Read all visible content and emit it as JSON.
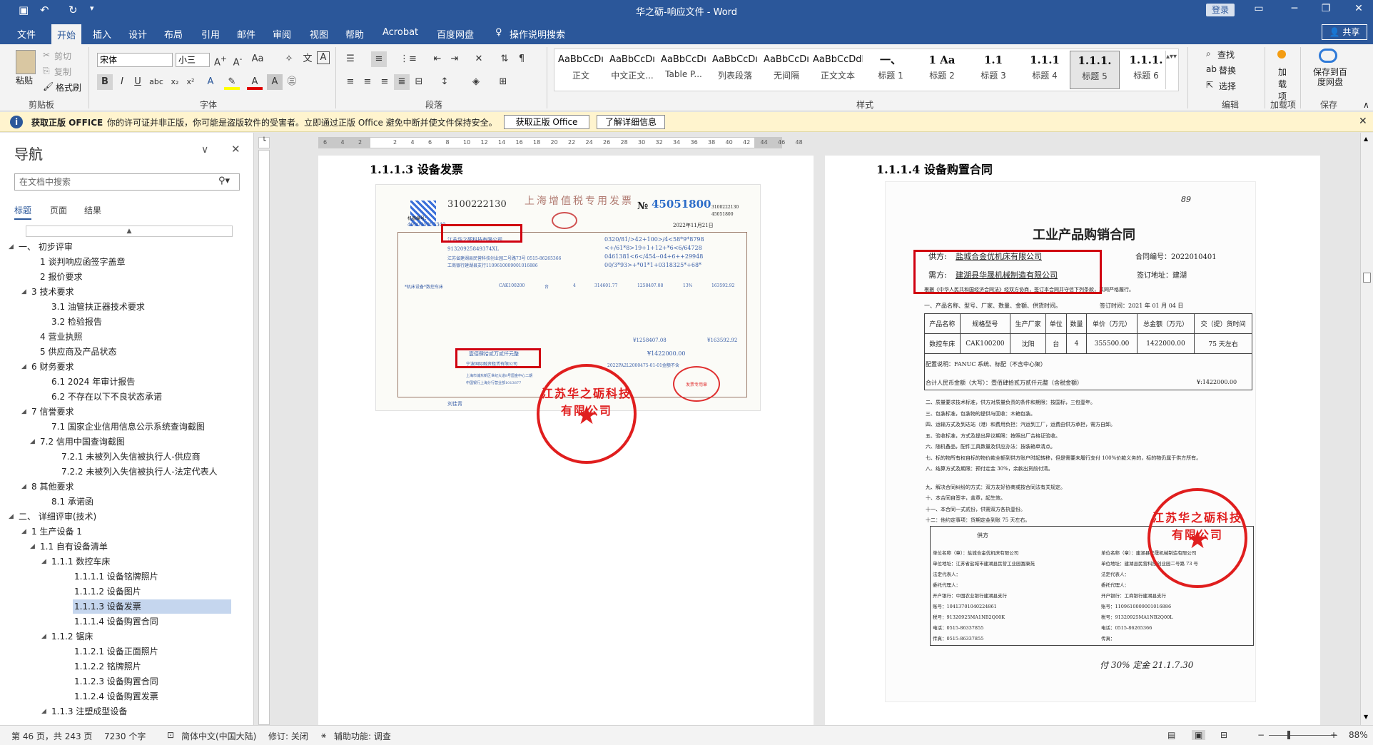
{
  "window": {
    "title": "华之砺-响应文件 - Word",
    "login_label": "登录",
    "share_label": "共享"
  },
  "tabs": [
    "文件",
    "开始",
    "插入",
    "设计",
    "布局",
    "引用",
    "邮件",
    "审阅",
    "视图",
    "帮助",
    "Acrobat",
    "百度网盘",
    "操作说明搜索"
  ],
  "ribbon": {
    "clipboard": {
      "paste": "粘贴",
      "cut": "剪切",
      "copy": "复制",
      "format_painter": "格式刷",
      "group": "剪贴板"
    },
    "font": {
      "name": "宋体",
      "size": "小三",
      "group": "字体"
    },
    "paragraph": {
      "group": "段落"
    },
    "styles": {
      "group": "样式",
      "items": [
        {
          "preview": "AaBbCcDı",
          "name": "正文"
        },
        {
          "preview": "AaBbCcDı",
          "name": "中文正文..."
        },
        {
          "preview": "AaBbCcDı",
          "name": "Table P..."
        },
        {
          "preview": "AaBbCcDı",
          "name": "列表段落"
        },
        {
          "preview": "AaBbCcDı",
          "name": "无间隔"
        },
        {
          "preview": "AaBbCcDdI",
          "name": "正文文本"
        },
        {
          "preview": "一、",
          "name": "标题 1"
        },
        {
          "preview": "1 Aa",
          "name": "标题 2"
        },
        {
          "preview": "1.1",
          "name": "标题 3"
        },
        {
          "preview": "1.1.1",
          "name": "标题 4"
        },
        {
          "preview": "1.1.1.",
          "name": "标题 5"
        },
        {
          "preview": "1.1.1.",
          "name": "标题 6"
        }
      ]
    },
    "editing": {
      "find": "查找",
      "replace": "替换",
      "select": "选择",
      "group": "编辑"
    },
    "addins": {
      "label": "加载项",
      "group": "加载项"
    },
    "save": {
      "label": "保存到百度网盘",
      "group": "保存"
    }
  },
  "message_bar": {
    "title": "获取正版 OFFICE",
    "text": "你的许可证并非正版，你可能是盗版软件的受害者。立即通过正版 Office 避免中断并使文件保持安全。",
    "button1": "获取正版 Office",
    "button2": "了解详细信息"
  },
  "nav": {
    "title": "导航",
    "search_placeholder": "在文档中搜索",
    "tabs": [
      "标题",
      "页面",
      "结果"
    ],
    "items": [
      {
        "text": "一、 初步评审",
        "level": 0,
        "arrow": "◢"
      },
      {
        "text": "1 谈判响应函签字盖章",
        "level": 2,
        "arrow": ""
      },
      {
        "text": "2 报价要求",
        "level": 2,
        "arrow": ""
      },
      {
        "text": "3 技术要求",
        "level": 1,
        "arrow": "◢"
      },
      {
        "text": "3.1 油管扶正器技术要求",
        "level": 3,
        "arrow": ""
      },
      {
        "text": "3.2 检验报告",
        "level": 3,
        "arrow": ""
      },
      {
        "text": "4 营业执照",
        "level": 2,
        "arrow": ""
      },
      {
        "text": "5 供应商及产品状态",
        "level": 2,
        "arrow": ""
      },
      {
        "text": "6 财务要求",
        "level": 1,
        "arrow": "◢"
      },
      {
        "text": "6.1 2024 年审计报告",
        "level": 3,
        "arrow": ""
      },
      {
        "text": "6.2 不存在以下不良状态承诺",
        "level": 3,
        "arrow": ""
      },
      {
        "text": "7 信誉要求",
        "level": 1,
        "arrow": "◢"
      },
      {
        "text": "7.1 国家企业信用信息公示系统查询截图",
        "level": 3,
        "arrow": ""
      },
      {
        "text": "7.2 信用中国查询截图",
        "level": 2,
        "arrow": "◢"
      },
      {
        "text": "7.2.1 未被列入失信被执行人-供应商",
        "level": 4,
        "arrow": ""
      },
      {
        "text": "7.2.2 未被列入失信被执行人-法定代表人",
        "level": 4,
        "arrow": ""
      },
      {
        "text": "8 其他要求",
        "level": 1,
        "arrow": "◢"
      },
      {
        "text": "8.1 承诺函",
        "level": 3,
        "arrow": ""
      },
      {
        "text": "二、 详细评审(技术)",
        "level": 0,
        "arrow": "◢"
      },
      {
        "text": "1 生产设备 1",
        "level": 1,
        "arrow": "◢"
      },
      {
        "text": "1.1 自有设备清单",
        "level": 2,
        "arrow": "◢"
      },
      {
        "text": "1.1.1 数控车床",
        "level": 3,
        "arrow": "◢"
      },
      {
        "text": "1.1.1.1 设备铭牌照片",
        "level": 5,
        "arrow": ""
      },
      {
        "text": "1.1.1.2 设备图片",
        "level": 5,
        "arrow": ""
      },
      {
        "text": "1.1.1.3 设备发票",
        "level": 5,
        "arrow": "",
        "selected": true
      },
      {
        "text": "1.1.1.4 设备购置合同",
        "level": 5,
        "arrow": ""
      },
      {
        "text": "1.1.2 锯床",
        "level": 3,
        "arrow": "◢"
      },
      {
        "text": "1.1.2.1 设备正面照片",
        "level": 5,
        "arrow": ""
      },
      {
        "text": "1.1.2.2 铭牌照片",
        "level": 5,
        "arrow": ""
      },
      {
        "text": "1.1.2.3 设备购置合同",
        "level": 5,
        "arrow": ""
      },
      {
        "text": "1.1.2.4 设备购置发票",
        "level": 5,
        "arrow": ""
      },
      {
        "text": "1.1.3 注塑成型设备",
        "level": 3,
        "arrow": "◢"
      }
    ]
  },
  "ruler_ticks": [
    "6",
    "4",
    "2",
    "",
    "2",
    "4",
    "6",
    "8",
    "10",
    "12",
    "14",
    "16",
    "18",
    "20",
    "22",
    "24",
    "26",
    "28",
    "30",
    "32",
    "34",
    "36",
    "38",
    "40",
    "42",
    "44",
    "46",
    "48"
  ],
  "pages": {
    "left": {
      "heading": "1.1.1.3  设备发票",
      "invoice": {
        "code": "3100222130",
        "title": "上海增值税专用发票",
        "no_prefix": "№",
        "number": "45051800",
        "code_small": "3100222130",
        "number_small": "45051800",
        "date": "2022年11月21日",
        "buyer_no": "机器编号：",
        "buyer_id": "499090953349",
        "buyer_name": "江苏华之砺科技有限公司",
        "buyer_tax": "91320925849374XL",
        "buyer_addr": "江苏省建湖县民营科技创业园二号路73号 0515-86265366",
        "buyer_bank": "工商银行建湖县支行1109610009001016886",
        "cipher1": "0320/81/>42+100>/4<58*9*8798",
        "cipher2": "<+/61*8>19+1+12+*6<6/64728",
        "cipher3": "0461381<6</454--04+6++29948",
        "cipher4": "00/3*93>+*01*1+0318325*+68*",
        "item": "*机床设备*数控车床",
        "model": "CAK100200",
        "unit": "台",
        "qty": "4",
        "price": "314601.77",
        "amount": "1258407.08",
        "rate": "13%",
        "tax": "163592.92",
        "total_amount": "¥1258407.08",
        "total_tax": "¥163592.92",
        "total_words": "壹佰肆拾贰万贰仟元整",
        "total_small": "¥1422000.00",
        "seller_name": "宁波国际融资租赁有限公司",
        "seller_addr": "上海市浦东新区世纪大道8号国金中心二期",
        "seller_bank": "中国银行上海分行营业部1013877",
        "remark": "2022PA2L2000475-01-01金额不含",
        "payee": "刘佳青",
        "seal_text": "发票专用章",
        "stamp_text": "江苏华之砺科技有限公司"
      }
    },
    "right": {
      "heading": "1.1.1.4  设备购置合同",
      "contract": {
        "page_mark": "89",
        "title": "工业产品购销合同",
        "supplier_label": "供方:",
        "supplier": "盐城合金优机床有限公司",
        "buyer_label": "需方:",
        "buyer": "建湖县华晟机械制造有限公司",
        "contract_no": "合同编号：2022010401",
        "sign_place": "签订地址：建湖",
        "intro": "根据《中华人民共和国经济合同法》经双方协商，签订本合同并守信下列条款，共同严格履行。",
        "clause1": "一、产品名称、型号、厂家、数量、金额、供货时间。",
        "sign_date": "签订时间：2021 年 01 月 04 日",
        "table_headers": [
          "产品名称",
          "规格型号",
          "生产厂家",
          "单位",
          "数量",
          "单价（万元）",
          "总金额（万元）",
          "交（提）货时间"
        ],
        "table_row": [
          "数控车床",
          "CAK100200",
          "沈阳",
          "台",
          "4",
          "355500.00",
          "1422000.00",
          "75 天左右"
        ],
        "config": "配置说明：FANUC 系统、标配（不含中心架）",
        "total": "合计人民币金额（大写）：壹佰肆拾贰万贰仟元整（含税金额）",
        "total_num": "¥:1422000.00",
        "clauses": [
          "二、质量要求技术标准，供方对质量负责的条件和期限：按国标，三包壹年。",
          "三、包装标准，包装物的提供与回收：木箱包装。",
          "四、运输方式及到达站（港）和费用负担：汽运到工厂，运费由供方承担，需方自卸。",
          "五、验收标准，方式及提出异议期限：按照出厂合格证验收。",
          "六、随机备品，配件工具数量及供应办法：按装箱单清点。",
          "七、标的物所有权自标的物价款全额到供方账户时起转移，但是需要未履行支付 100%价款义务的，标的物仍属于供方所有。",
          "八、结算方式及期限：预付定金 30%，余款出货前付清。",
          "九、解决合同纠纷的方式：双方友好协商或按合同法有关规定。",
          "十、本合同自签字，盖章，起生效。",
          "十一、本合同一式贰份，供需双方各执壹份。",
          "十二：他约定事项：货期定金到账 75 天左右。"
        ],
        "supplier_block_title": "供方",
        "s_unit": "单位名称（章）：盐城合金优机床有限公司",
        "s_addr": "单位地址：江苏省盐城市建湖县民营工业园富康苑",
        "s_legal": "法定代表人：",
        "s_agent": "委托代理人：",
        "s_bank": "开户银行：中国农业银行建湖县支行",
        "s_acct": "账号：10413701040224861",
        "s_tax": "税号：91320925MA1NB2Q00K",
        "s_tel": "电话：0515-86337855",
        "s_fax": "传真：0515-86337855",
        "b_unit": "单位名称（章）：建湖县华晟机械制造有限公司",
        "b_addr": "单位地址：建湖县民营科技创业园二号路 73 号",
        "b_legal": "法定代表人：",
        "b_agent": "委托代理人：",
        "b_bank": "开户银行：工商银行建湖县支行",
        "b_acct": "账号：1109610009001016886",
        "b_tax": "税号：91320925MA1NB2Q00L",
        "b_tel": "电话：0515-86265366",
        "b_fax": "传真：",
        "handwriting": "付 30% 定金    21.1.7.30",
        "stamp_text": "江苏华之砺科技有限公司"
      }
    }
  },
  "status": {
    "page": "第 46 页，共 243 页",
    "words": "7230 个字",
    "lang": "简体中文(中国大陆)",
    "track": "修订: 关闭",
    "access": "辅助功能: 调查",
    "zoom": "88%"
  }
}
